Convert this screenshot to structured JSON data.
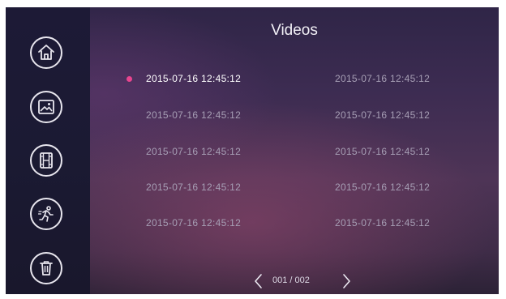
{
  "header": {
    "title": "Videos"
  },
  "sidebar": {
    "items": [
      {
        "name": "home",
        "icon": "home-icon"
      },
      {
        "name": "pictures",
        "icon": "image-icon"
      },
      {
        "name": "videos",
        "icon": "film-icon"
      },
      {
        "name": "motion",
        "icon": "running-person-icon"
      },
      {
        "name": "delete",
        "icon": "trash-icon"
      }
    ]
  },
  "videos": {
    "left": [
      {
        "label": "2015-07-16  12:45:12",
        "selected": true
      },
      {
        "label": "2015-07-16  12:45:12"
      },
      {
        "label": "2015-07-16  12:45:12"
      },
      {
        "label": "2015-07-16  12:45:12"
      },
      {
        "label": "2015-07-16  12:45:12"
      }
    ],
    "right": [
      {
        "label": "2015-07-16  12:45:12"
      },
      {
        "label": "2015-07-16  12:45:12"
      },
      {
        "label": "2015-07-16  12:45:12"
      },
      {
        "label": "2015-07-16  12:45:12"
      },
      {
        "label": "2015-07-16  12:45:12"
      }
    ]
  },
  "pager": {
    "page_text": "001 / 002",
    "prev_icon": "chevron-left-icon",
    "next_icon": "chevron-right-icon"
  },
  "colors": {
    "accent": "#e9458f",
    "sidebar": "#1c1a34",
    "text_active": "#ffffff",
    "text_inactive": "#a79fb5"
  }
}
